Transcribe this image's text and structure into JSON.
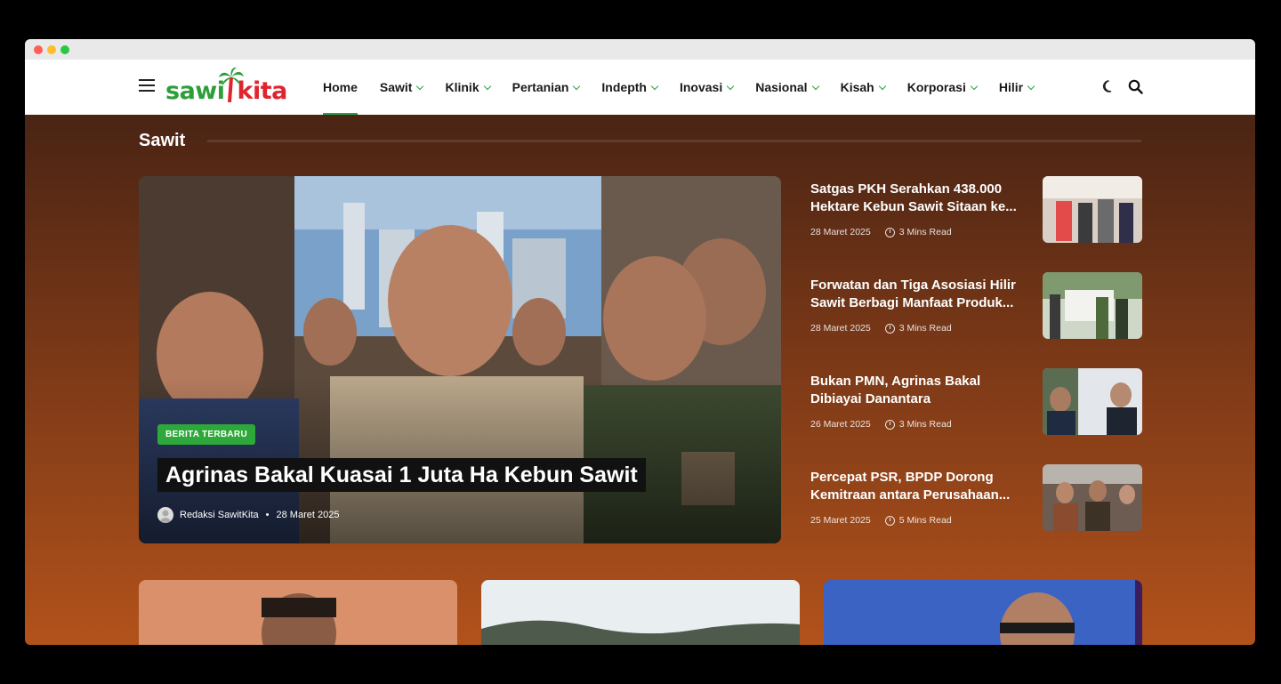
{
  "brand": {
    "logo_part1": "sawi",
    "logo_part2": "kita"
  },
  "nav": {
    "items": [
      {
        "label": "Home",
        "active": true,
        "has_dropdown": false
      },
      {
        "label": "Sawit",
        "has_dropdown": true
      },
      {
        "label": "Klinik",
        "has_dropdown": true
      },
      {
        "label": "Pertanian",
        "has_dropdown": true
      },
      {
        "label": "Indepth",
        "has_dropdown": true
      },
      {
        "label": "Inovasi",
        "has_dropdown": true
      },
      {
        "label": "Nasional",
        "has_dropdown": true
      },
      {
        "label": "Kisah",
        "has_dropdown": true
      },
      {
        "label": "Korporasi",
        "has_dropdown": true
      },
      {
        "label": "Hilir",
        "has_dropdown": true
      }
    ],
    "icons": [
      "menu-icon",
      "moon-icon",
      "search-icon"
    ],
    "accent_color": "#27a244"
  },
  "section": {
    "title": "Sawit"
  },
  "hero": {
    "badge": "BERITA TERBARU",
    "title": "Agrinas Bakal Kuasai 1 Juta Ha Kebun Sawit",
    "author": "Redaksi SawitKita",
    "separator": "•",
    "date": "28 Maret 2025"
  },
  "sidebar": {
    "items": [
      {
        "title": "Satgas PKH Serahkan 438.000 Hektare Kebun Sawit Sitaan ke...",
        "date": "28 Maret 2025",
        "read": "3 Mins Read"
      },
      {
        "title": "Forwatan dan Tiga Asosiasi Hilir Sawit Berbagi Manfaat Produk...",
        "date": "28 Maret 2025",
        "read": "3 Mins Read"
      },
      {
        "title": "Bukan PMN, Agrinas Bakal Dibiayai Danantara",
        "date": "26 Maret 2025",
        "read": "3 Mins Read"
      },
      {
        "title": "Percepat PSR, BPDP Dorong Kemitraan antara Perusahaan...",
        "date": "25 Maret 2025",
        "read": "5 Mins Read"
      }
    ]
  },
  "colors": {
    "badge": "#2ea83a",
    "logo_green": "#2e9e3a",
    "logo_red": "#e0242e"
  }
}
